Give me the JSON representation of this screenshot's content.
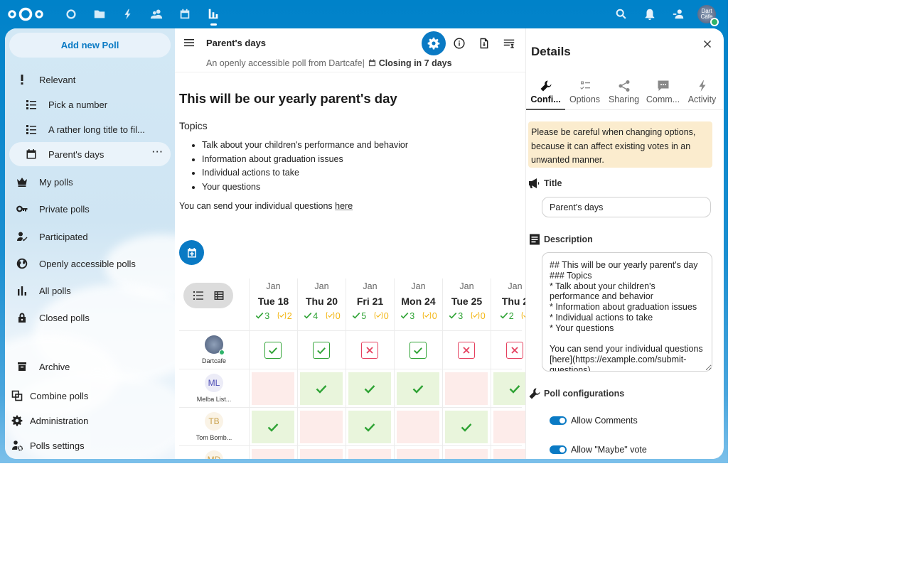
{
  "header": {
    "apps": [
      {
        "name": "dashboard",
        "icon": "circle-icon",
        "active": false
      },
      {
        "name": "files",
        "icon": "folder-icon",
        "active": false
      },
      {
        "name": "activity",
        "icon": "lightning-icon",
        "active": false
      },
      {
        "name": "contacts",
        "icon": "contacts-icon",
        "active": false
      },
      {
        "name": "calendar",
        "icon": "calendar-icon",
        "active": false
      },
      {
        "name": "polls",
        "icon": "polls-icon",
        "active": true
      }
    ],
    "user_avatar_text": "Dart Cafe",
    "user_status": "online"
  },
  "navigation": {
    "new_poll_label": "Add new Poll",
    "items": [
      {
        "label": "Relevant",
        "icon": "exclamation-icon"
      },
      {
        "label": "Pick a number",
        "icon": "text-poll-icon",
        "sub": true
      },
      {
        "label": "A rather long title to fil...",
        "icon": "text-poll-icon",
        "sub": true
      },
      {
        "label": "Parent's days",
        "icon": "calendar-icon",
        "sub": true,
        "active": true
      },
      {
        "label": "My polls",
        "icon": "crown-icon"
      },
      {
        "label": "Private polls",
        "icon": "key-icon"
      },
      {
        "label": "Participated",
        "icon": "user-check-icon"
      },
      {
        "label": "Openly accessible polls",
        "icon": "globe-icon"
      },
      {
        "label": "All polls",
        "icon": "bar-chart-icon"
      },
      {
        "label": "Closed polls",
        "icon": "lock-icon"
      },
      {
        "label": "Archive",
        "icon": "archive-icon"
      }
    ],
    "footer": [
      {
        "label": "Combine polls",
        "icon": "combine-icon"
      },
      {
        "label": "Administration",
        "icon": "gear-icon"
      },
      {
        "label": "Polls settings",
        "icon": "user-settings-icon"
      }
    ]
  },
  "poll": {
    "title": "Parent's days",
    "subtitle_prefix": "An openly accessible poll from Dartcafe",
    "subtitle_sep": "|",
    "closing": "Closing in 7 days",
    "heading": "This will be our yearly parent's day",
    "topics_label": "Topics",
    "topics": [
      "Talk about your children's performance and behavior",
      "Information about graduation issues",
      "Individual actions to take",
      "Your questions"
    ],
    "questions_text": "You can send your individual questions ",
    "questions_link": "here"
  },
  "vote_table": {
    "columns": [
      {
        "month": "Jan",
        "day": "Tue 18",
        "yes": "3",
        "maybe": "2"
      },
      {
        "month": "Jan",
        "day": "Thu 20",
        "yes": "4",
        "maybe": "0"
      },
      {
        "month": "Jan",
        "day": "Fri 21",
        "yes": "5",
        "maybe": "0"
      },
      {
        "month": "Jan",
        "day": "Mon 24",
        "yes": "3",
        "maybe": "0"
      },
      {
        "month": "Jan",
        "day": "Tue 25",
        "yes": "3",
        "maybe": "0"
      },
      {
        "month": "Jan",
        "day": "Thu 2",
        "yes": "2",
        "maybe": ""
      }
    ],
    "rows": [
      {
        "user": "Dartcafe",
        "initials": "",
        "own": true,
        "votes": [
          "yes",
          "yes",
          "no",
          "yes",
          "no",
          "no"
        ]
      },
      {
        "user": "Melba List...",
        "initials": "ML",
        "votes": [
          "no",
          "yes",
          "yes",
          "yes",
          "no",
          "yes"
        ]
      },
      {
        "user": "Tom Bomb...",
        "initials": "TB",
        "votes": [
          "yes",
          "no",
          "yes",
          "no",
          "yes",
          "no"
        ]
      },
      {
        "user": "",
        "initials": "MD",
        "votes": [
          "no",
          "no",
          "no",
          "no",
          "no",
          "no"
        ]
      }
    ],
    "colors": {
      "yes": "#2fa335",
      "no": "#e5405e",
      "maybe": "#f3b716"
    }
  },
  "sidebar": {
    "title": "Details",
    "tabs": [
      {
        "label": "Confi...",
        "icon": "wrench-icon",
        "active": true
      },
      {
        "label": "Options",
        "icon": "checklist-icon"
      },
      {
        "label": "Sharing",
        "icon": "share-icon"
      },
      {
        "label": "Comm...",
        "icon": "comment-icon"
      },
      {
        "label": "Activity",
        "icon": "lightning-icon"
      }
    ],
    "warning": "Please be careful when changing options, because it can affect existing votes in an unwanted manner.",
    "title_label": "Title",
    "title_value": "Parent's days",
    "description_label": "Description",
    "description_value": "## This will be our yearly parent's day\n### Topics\n* Talk about your children's performance and behavior\n* Information about graduation issues\n* Individual actions to take\n* Your questions\n\nYou can send your individual questions [here](https://example.com/submit-questions)",
    "config_label": "Poll configurations",
    "toggles": [
      {
        "label": "Allow Comments",
        "on": true
      },
      {
        "label": "Allow \"Maybe\" vote",
        "on": true
      }
    ]
  }
}
